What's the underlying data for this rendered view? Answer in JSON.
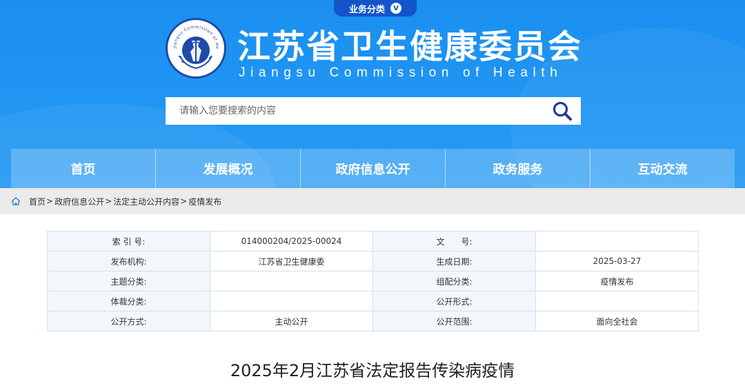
{
  "header": {
    "biz_tab": {
      "label": "业务分类",
      "toggle": "V"
    },
    "logo_text": "Jiangsu Commission of Health",
    "title": "江苏省卫生健康委员会",
    "subtitle": "Jiangsu Commission of Health",
    "accent": "#1a8ff0"
  },
  "search": {
    "placeholder": "请输入您要搜索的内容",
    "value": "",
    "icon": "search-icon"
  },
  "nav": {
    "items": [
      "首页",
      "发展概况",
      "政府信息公开",
      "政务服务",
      "互动交流"
    ]
  },
  "breadcrumb": {
    "icon": "home-icon",
    "items": [
      "首页",
      "政府信息公开",
      "法定主动公开内容",
      "疫情发布"
    ],
    "separator": ">"
  },
  "meta_table": {
    "rows": [
      {
        "label1": "索 引 号:",
        "value1": "014000204/2025-00024",
        "label2": "文　　号:",
        "value2": ""
      },
      {
        "label1": "发布机构:",
        "value1": "江苏省卫生健康委",
        "label2": "生成日期:",
        "value2": "2025-03-27"
      },
      {
        "label1": "主题分类:",
        "value1": "",
        "label2": "组配分类:",
        "value2": "疫情发布"
      },
      {
        "label1": "体裁分类:",
        "value1": "",
        "label2": "公开形式:",
        "value2": ""
      },
      {
        "label1": "公开方式:",
        "value1": "主动公开",
        "label2": "公开范围:",
        "value2": "面向全社会"
      }
    ]
  },
  "article": {
    "title": "2025年2月江苏省法定报告传染病疫情"
  }
}
